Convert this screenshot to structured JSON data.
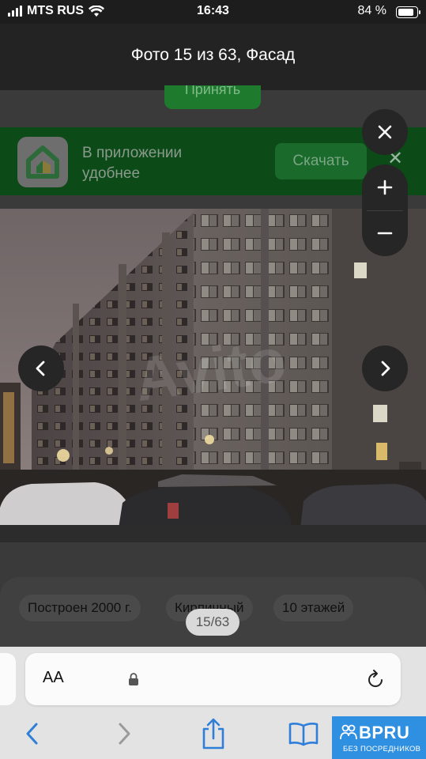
{
  "status_bar": {
    "carrier": "MTS RUS",
    "time": "16:43",
    "battery_percent": "84 %",
    "battery_level": 0.84
  },
  "viewer": {
    "title": "Фото 15 из 63, Фасад",
    "counter": "15/63",
    "close_icon": "close-icon",
    "zoom_in_icon": "plus-icon",
    "zoom_out_icon": "minus-icon",
    "prev_icon": "chevron-left-icon",
    "next_icon": "chevron-right-icon"
  },
  "page_behind": {
    "accept_label": "Принять",
    "app_banner": {
      "text": "В приложении удобнее",
      "download_label": "Скачать"
    },
    "chips": [
      {
        "label": "Построен 2000 г."
      },
      {
        "label": "Кирпичный"
      },
      {
        "label": "10 этажей"
      }
    ]
  },
  "safari": {
    "text_size_label": "AA",
    "toolbar_icons": [
      "back-icon",
      "forward-icon",
      "share-icon",
      "bookmarks-icon"
    ]
  },
  "watermark": {
    "brand": "BPRU",
    "tagline": "БЕЗ ПОСРЕДНИКОВ"
  },
  "colors": {
    "banner_green": "#0c4a17",
    "button_green": "#1e7b2d",
    "bpru_blue": "#2f8fe0"
  }
}
